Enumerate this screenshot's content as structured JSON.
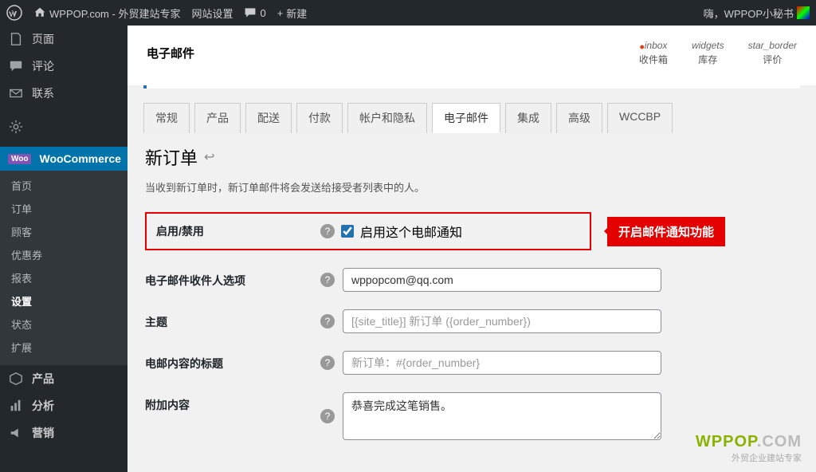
{
  "adminbar": {
    "site": "WPPOP.com - 外贸建站专家",
    "settings": "网站设置",
    "comments": "0",
    "new": "新建",
    "greeting": "嗨，WPPOP小秘书"
  },
  "sidebar": {
    "pages": "页面",
    "comments": "评论",
    "contact": "联系",
    "woocommerce": "WooCommerce",
    "sub": {
      "home": "首页",
      "orders": "订单",
      "customers": "顾客",
      "coupons": "优惠券",
      "reports": "报表",
      "settings": "设置",
      "status": "状态",
      "extensions": "扩展"
    },
    "products": "产品",
    "analytics": "分析",
    "marketing": "营销"
  },
  "header": {
    "title": "电子邮件",
    "icons": {
      "inbox_top": "inbox",
      "inbox_bot": "收件箱",
      "widgets_top": "widgets",
      "widgets_bot": "库存",
      "star_top": "star_border",
      "star_bot": "评价"
    }
  },
  "tabs": {
    "general": "常规",
    "products": "产品",
    "shipping": "配送",
    "payments": "付款",
    "accounts": "帐户和隐私",
    "emails": "电子邮件",
    "integration": "集成",
    "advanced": "高级",
    "wccbp": "WCCBP"
  },
  "page": {
    "h2": "新订单",
    "desc": "当收到新订单时，新订单邮件将会发送给接受者列表中的人。"
  },
  "form": {
    "enable": {
      "label": "启用/禁用",
      "checkbox_label": "启用这个电邮通知",
      "callout": "开启邮件通知功能"
    },
    "recipient": {
      "label": "电子邮件收件人选项",
      "value": "wppopcom@qq.com"
    },
    "subject": {
      "label": "主题",
      "placeholder": "[{site_title}] 新订单 ({order_number})"
    },
    "heading": {
      "label": "电邮内容的标题",
      "placeholder": "新订单：#{order_number}"
    },
    "additional": {
      "label": "附加内容",
      "value": "恭喜完成这笔销售。"
    }
  },
  "watermark": {
    "main": "WPPOP",
    "com": ".COM",
    "sub": "外贸企业建站专家"
  }
}
